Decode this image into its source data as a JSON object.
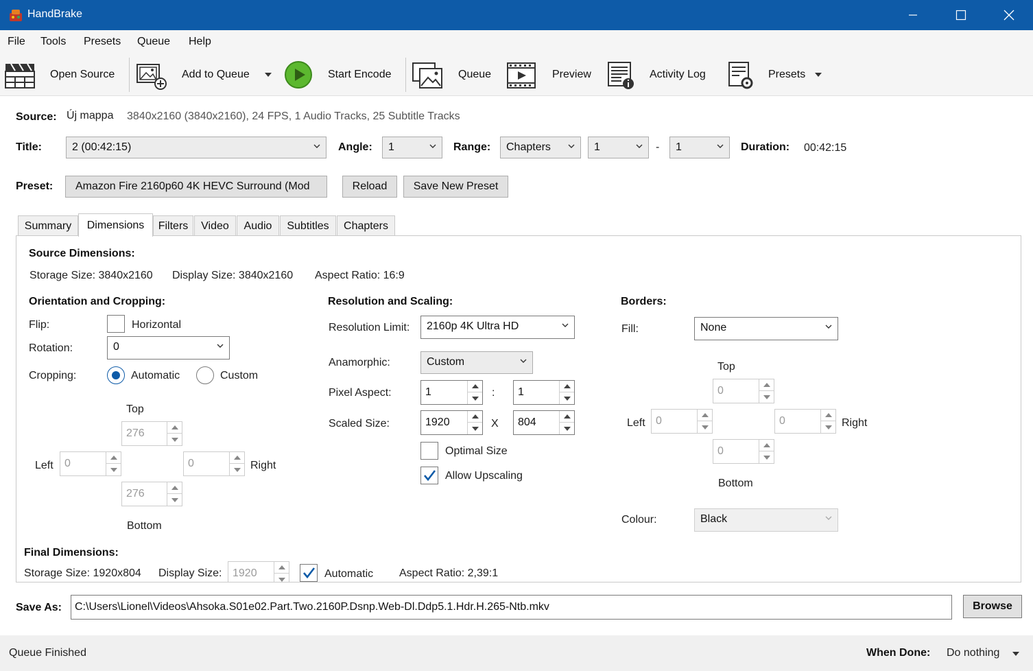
{
  "window": {
    "title": "HandBrake",
    "accent": "#0e5ba8"
  },
  "menu": [
    "File",
    "Tools",
    "Presets",
    "Queue",
    "Help"
  ],
  "toolbar": {
    "open_source": "Open Source",
    "add_to_queue": "Add to Queue",
    "start_encode": "Start Encode",
    "queue": "Queue",
    "preview": "Preview",
    "activity_log": "Activity Log",
    "presets": "Presets"
  },
  "source": {
    "label": "Source:",
    "name": "Új mappa",
    "info": "3840x2160 (3840x2160), 24 FPS, 1 Audio Tracks, 25 Subtitle Tracks"
  },
  "title_row": {
    "title_label": "Title:",
    "title_value": "2  (00:42:15)",
    "angle_label": "Angle:",
    "angle_value": "1",
    "range_label": "Range:",
    "range_mode": "Chapters",
    "range_start": "1",
    "range_sep": "-",
    "range_end": "1",
    "duration_label": "Duration:",
    "duration_value": "00:42:15"
  },
  "preset_row": {
    "label": "Preset:",
    "value": "Amazon Fire 2160p60 4K HEVC Surround  (Mod",
    "reload": "Reload",
    "save_new": "Save New Preset"
  },
  "tabs": [
    "Summary",
    "Dimensions",
    "Filters",
    "Video",
    "Audio",
    "Subtitles",
    "Chapters"
  ],
  "dimensions": {
    "source_heading": "Source Dimensions:",
    "storage_size": "Storage Size: 3840x2160",
    "display_size": "Display Size: 3840x2160",
    "aspect_ratio": "Aspect Ratio: 16:9",
    "orientation": {
      "heading": "Orientation and Cropping:",
      "flip_label": "Flip:",
      "flip_option": "Horizontal",
      "rotation_label": "Rotation:",
      "rotation_value": "0",
      "cropping_label": "Cropping:",
      "automatic": "Automatic",
      "custom": "Custom",
      "top_label": "Top",
      "top": "276",
      "left_label": "Left",
      "left": "0",
      "right_label": "Right",
      "right": "0",
      "bottom_label": "Bottom",
      "bottom": "276"
    },
    "resolution": {
      "heading": "Resolution and Scaling:",
      "limit_label": "Resolution Limit:",
      "limit_value": "2160p 4K Ultra HD",
      "anamorphic_label": "Anamorphic:",
      "anamorphic_value": "Custom",
      "pixel_aspect_label": "Pixel Aspect:",
      "pixel_aspect_x": "1",
      "pixel_aspect_sep": ":",
      "pixel_aspect_y": "1",
      "scaled_label": "Scaled Size:",
      "scaled_w": "1920",
      "scaled_sep": "X",
      "scaled_h": "804",
      "optimal_size": "Optimal Size",
      "allow_upscaling": "Allow Upscaling"
    },
    "borders": {
      "heading": "Borders:",
      "fill_label": "Fill:",
      "fill_value": "None",
      "top_label": "Top",
      "top": "0",
      "left_label": "Left",
      "left": "0",
      "right_label": "Right",
      "right": "0",
      "bottom_label": "Bottom",
      "bottom": "0",
      "colour_label": "Colour:",
      "colour_value": "Black"
    },
    "final": {
      "heading": "Final Dimensions:",
      "storage_size": "Storage Size: 1920x804",
      "display_label": "Display Size:",
      "display_value": "1920",
      "automatic": "Automatic",
      "aspect_ratio": "Aspect Ratio: 2,39:1"
    }
  },
  "save_as": {
    "label": "Save As:",
    "path": "C:\\Users\\Lionel\\Videos\\Ahsoka.S01e02.Part.Two.2160P.Dsnp.Web-Dl.Ddp5.1.Hdr.H.265-Ntb.mkv",
    "browse": "Browse"
  },
  "status": {
    "message": "Queue Finished",
    "when_done_label": "When Done:",
    "when_done_value": "Do nothing"
  }
}
